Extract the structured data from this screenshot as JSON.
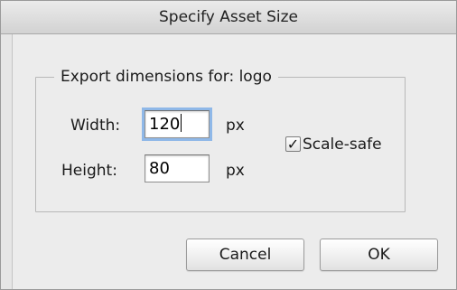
{
  "dialog": {
    "title": "Specify Asset Size",
    "group_label": "Export dimensions for: logo",
    "width_label": "Width:",
    "width_value": "120",
    "width_unit": "px",
    "height_label": "Height:",
    "height_value": "80",
    "height_unit": "px",
    "scale_safe_label": "Scale-safe",
    "scale_safe_checked": true,
    "check_glyph": "✓",
    "cancel_label": "Cancel",
    "ok_label": "OK"
  },
  "colors": {
    "focus_ring": "#8fb8e8",
    "background": "#ececec"
  }
}
